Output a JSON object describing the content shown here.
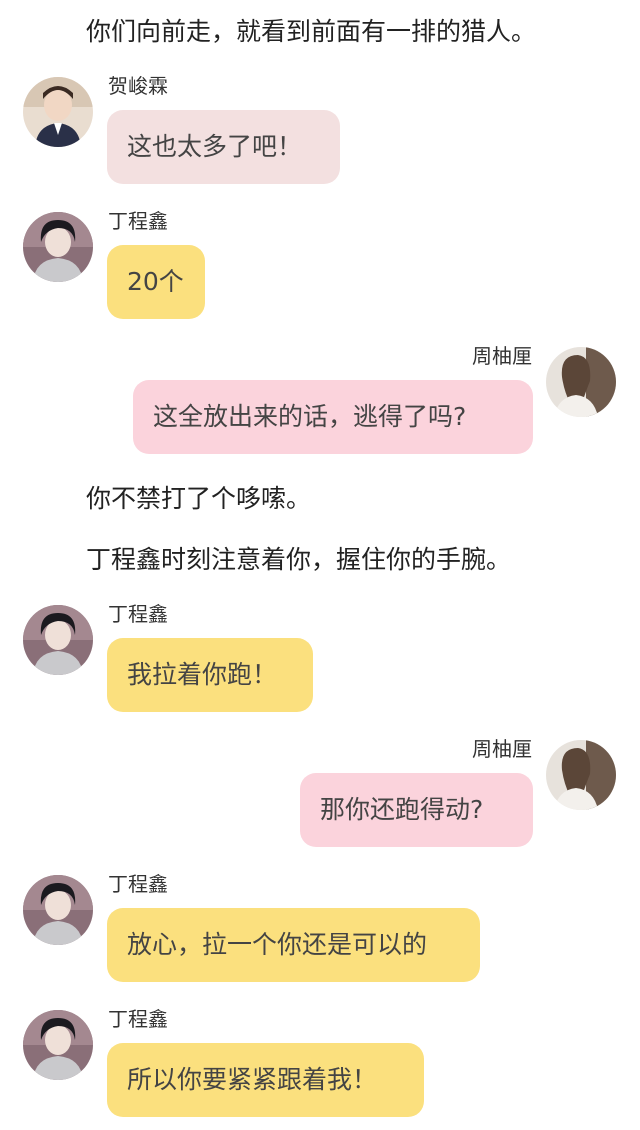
{
  "narration": [
    "你们向前走，就看到前面有一排的猎人。",
    "你不禁打了个哆嗦。",
    "丁程鑫时刻注意着你，握住你的手腕。"
  ],
  "messages": [
    {
      "sender": "贺峻霖",
      "text": "这也太多了吧！"
    },
    {
      "sender": "丁程鑫",
      "text": "20个"
    },
    {
      "sender": "周柚厘",
      "text": "这全放出来的话，逃得了吗?"
    },
    {
      "sender": "丁程鑫",
      "text": "我拉着你跑！"
    },
    {
      "sender": "周柚厘",
      "text": "那你还跑得动?"
    },
    {
      "sender": "丁程鑫",
      "text": "放心，拉一个你还是可以的"
    },
    {
      "sender": "丁程鑫",
      "text": "所以你要紧紧跟着我！"
    }
  ],
  "colors": {
    "bubble_he": "#f3e0e0",
    "bubble_ding": "#fbe07e",
    "bubble_zhou": "#fbd3dc"
  },
  "icons": {
    "avatar_he": "avatar-portrait-suit",
    "avatar_ding": "avatar-portrait-dark-hair",
    "avatar_zhou": "avatar-portrait-long-hair"
  }
}
